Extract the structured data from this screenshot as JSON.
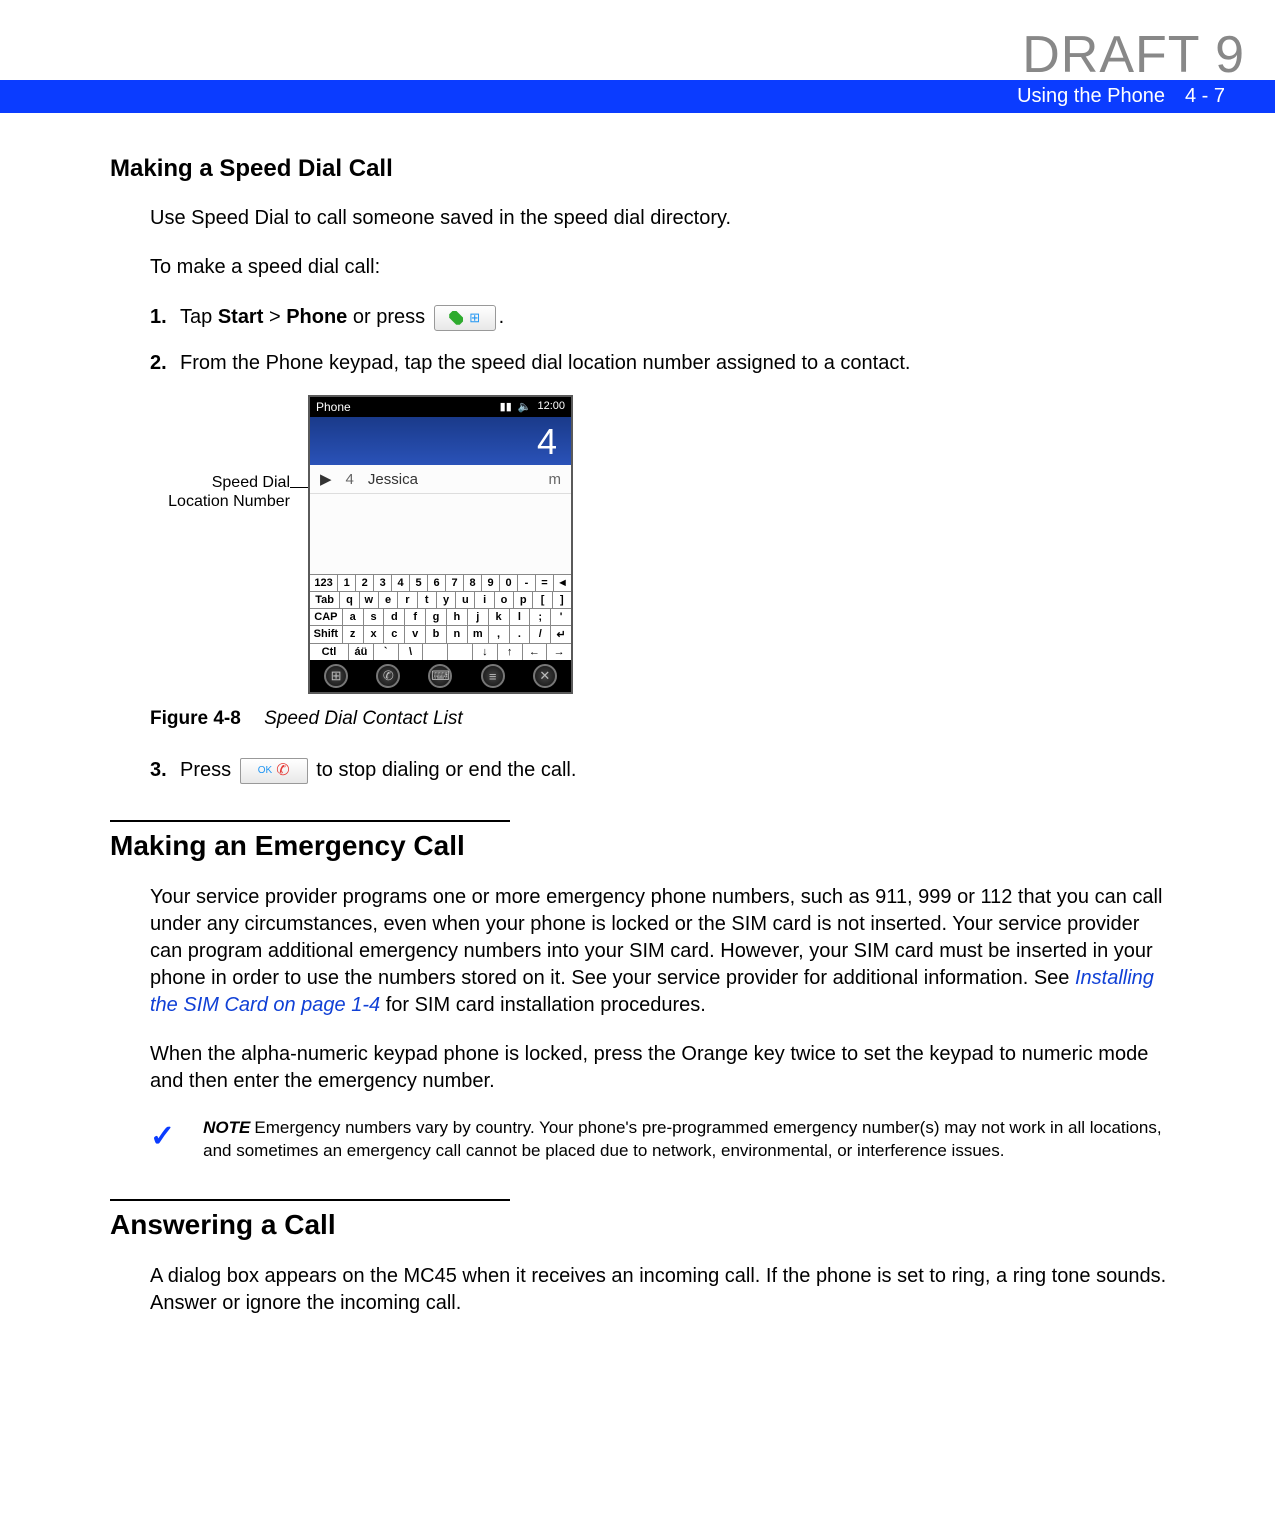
{
  "draft": "DRAFT 9",
  "header": {
    "title": "Using the Phone",
    "page": "4 - 7"
  },
  "s1": {
    "heading": "Making a Speed Dial Call",
    "intro1": "Use Speed Dial to call someone saved in the speed dial directory.",
    "intro2": "To make a speed dial call:",
    "step1": {
      "num": "1.",
      "pre": "Tap ",
      "b1": "Start",
      "gt": " > ",
      "b2": "Phone",
      "mid": " or press ",
      "post": "."
    },
    "step2": {
      "num": "2.",
      "text": "From the Phone keypad, tap the speed dial location number assigned to a contact."
    },
    "callout_l1": "Speed Dial",
    "callout_l2": "Location Number",
    "phone": {
      "title": "Phone",
      "time": "12:00",
      "dialed": "4",
      "entry": {
        "num": "4",
        "name": "Jessica",
        "type": "m"
      },
      "kb": {
        "r1": [
          "123",
          "1",
          "2",
          "3",
          "4",
          "5",
          "6",
          "7",
          "8",
          "9",
          "0",
          "-",
          "=",
          "◄"
        ],
        "r2": [
          "Tab",
          "q",
          "w",
          "e",
          "r",
          "t",
          "y",
          "u",
          "i",
          "o",
          "p",
          "[",
          "]"
        ],
        "r3": [
          "CAP",
          "a",
          "s",
          "d",
          "f",
          "g",
          "h",
          "j",
          "k",
          "l",
          ";",
          "'"
        ],
        "r4": [
          "Shift",
          "z",
          "x",
          "c",
          "v",
          "b",
          "n",
          "m",
          ",",
          ".",
          "/",
          "↵"
        ],
        "r5": [
          "Ctl",
          "áü",
          "`",
          "\\",
          " ",
          " ",
          "↓",
          "↑",
          "←",
          "→"
        ]
      }
    },
    "figure": {
      "label": "Figure 4-8",
      "title": "Speed Dial Contact List"
    },
    "step3": {
      "num": "3.",
      "pre": "Press ",
      "btn_ok": "OK",
      "post": " to stop dialing or end the call."
    }
  },
  "s2": {
    "heading": "Making an Emergency Call",
    "p1a": "Your service provider programs one or more emergency phone numbers, such as 911, 999 or 112 that you can call under any circumstances, even when your phone is locked or the SIM card is not inserted. Your service provider can program additional emergency numbers into your SIM card. However, your SIM card must be inserted in your phone in order to use the numbers stored on it. See your service provider for additional information. See ",
    "p1_xref": "Installing the SIM Card on page 1-4",
    "p1b": " for SIM card installation procedures.",
    "p2": "When the alpha-numeric keypad phone is locked, press the Orange key twice to set the keypad to numeric mode and then enter the emergency number.",
    "note_label": "NOTE",
    "note_text": "Emergency numbers vary by country. Your phone's pre-programmed emergency number(s) may not work in all locations, and sometimes an emergency call cannot be placed due to network, environmental, or interference issues."
  },
  "s3": {
    "heading": "Answering a Call",
    "p1": "A dialog box appears on the MC45 when it receives an incoming call. If the phone is set to ring, a ring tone sounds. Answer or ignore the incoming call."
  }
}
